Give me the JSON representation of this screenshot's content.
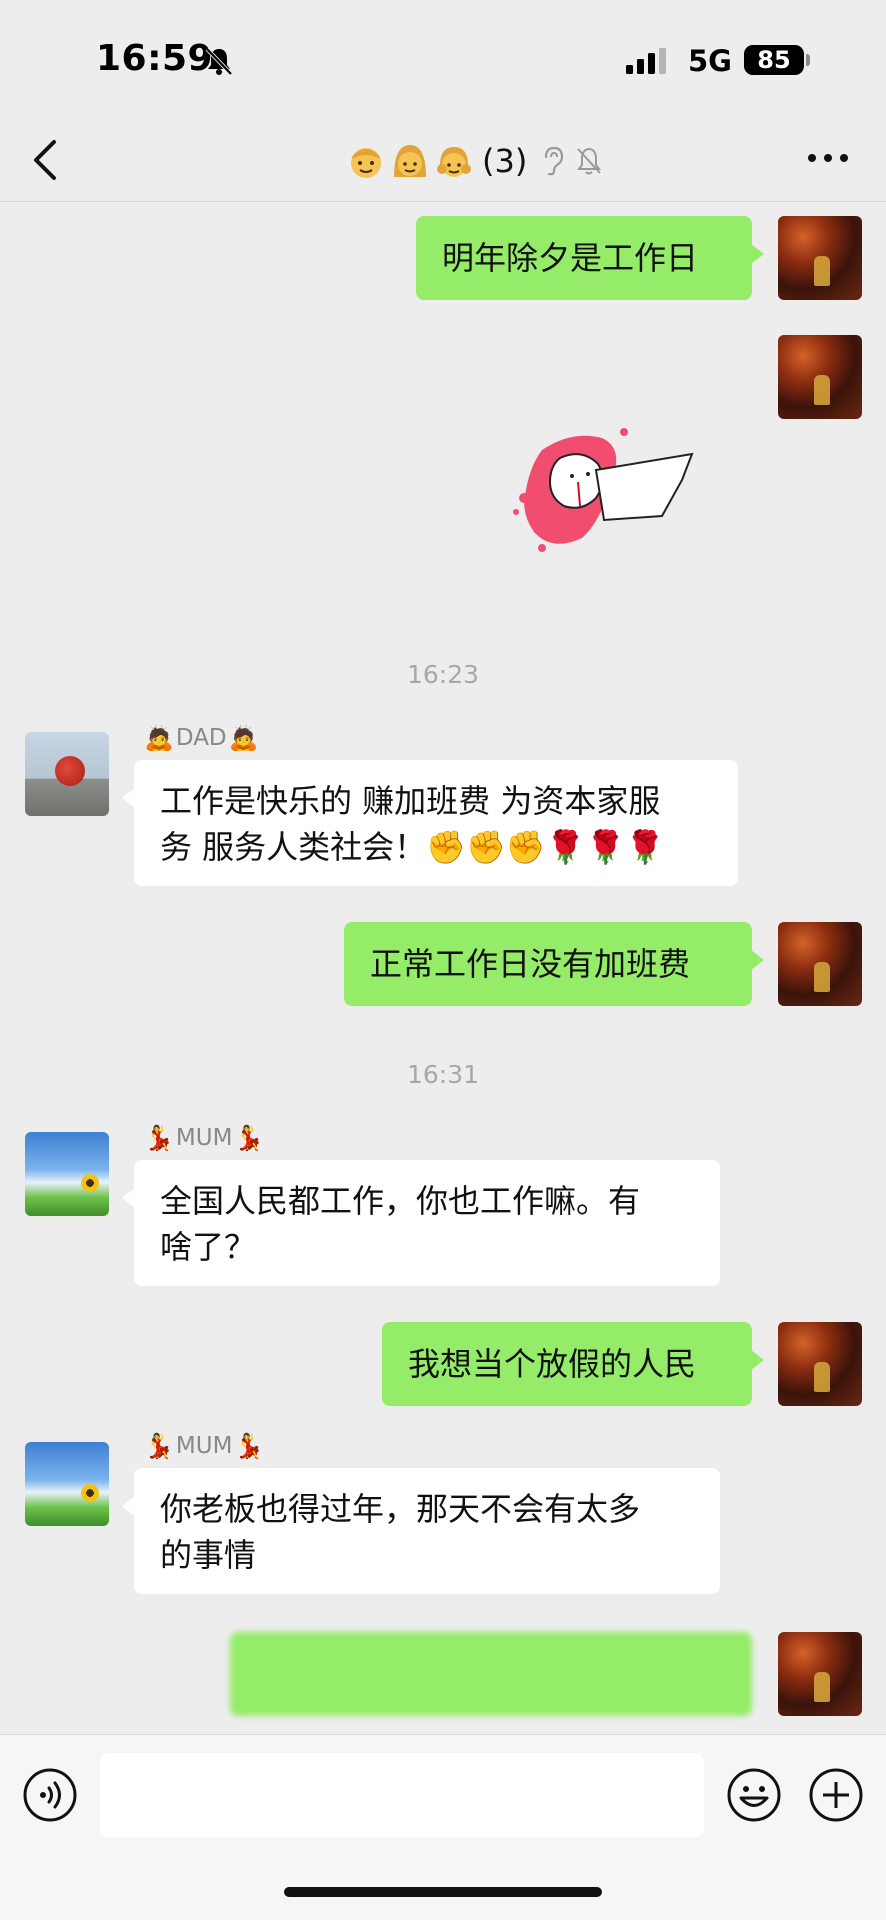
{
  "status_bar": {
    "time": "16:59",
    "network": "5G",
    "battery": "85"
  },
  "header": {
    "member_count": "(3)",
    "icons": [
      "back-icon",
      "man-face-icon",
      "woman-face-icon",
      "girl-face-icon",
      "ear-icon",
      "bell-muted-icon",
      "more-icon"
    ]
  },
  "messages": [
    {
      "from": "self",
      "text": "明年除夕是工作日"
    },
    {
      "from": "self",
      "type": "sticker"
    },
    {
      "type": "time",
      "text": "16:23"
    },
    {
      "from": "DAD",
      "sender_emoji": "🙇",
      "text_line1": "工作是快乐的 赚加班费 为资本家服",
      "text_line2": "务 服务人类社会！✊✊✊🌹🌹🌹"
    },
    {
      "from": "self",
      "text": "正常工作日没有加班费"
    },
    {
      "type": "time",
      "text": "16:31"
    },
    {
      "from": "MUM",
      "sender_emoji": "💃",
      "text_line1": "全国人民都工作，你也工作嘛。有",
      "text_line2": "啥了？"
    },
    {
      "from": "self",
      "text": "我想当个放假的人民"
    },
    {
      "from": "MUM",
      "sender_emoji": "💃",
      "text_line1": "你老板也得过年，那天不会有太多",
      "text_line2": "的事情"
    },
    {
      "from": "self",
      "type": "blurred"
    }
  ],
  "input_bar": {
    "placeholder": "",
    "icons": [
      "voice-icon",
      "emoji-icon",
      "plus-icon"
    ]
  },
  "colors": {
    "background": "#ededed",
    "self_bubble": "#95ec69",
    "other_bubble": "#ffffff"
  }
}
